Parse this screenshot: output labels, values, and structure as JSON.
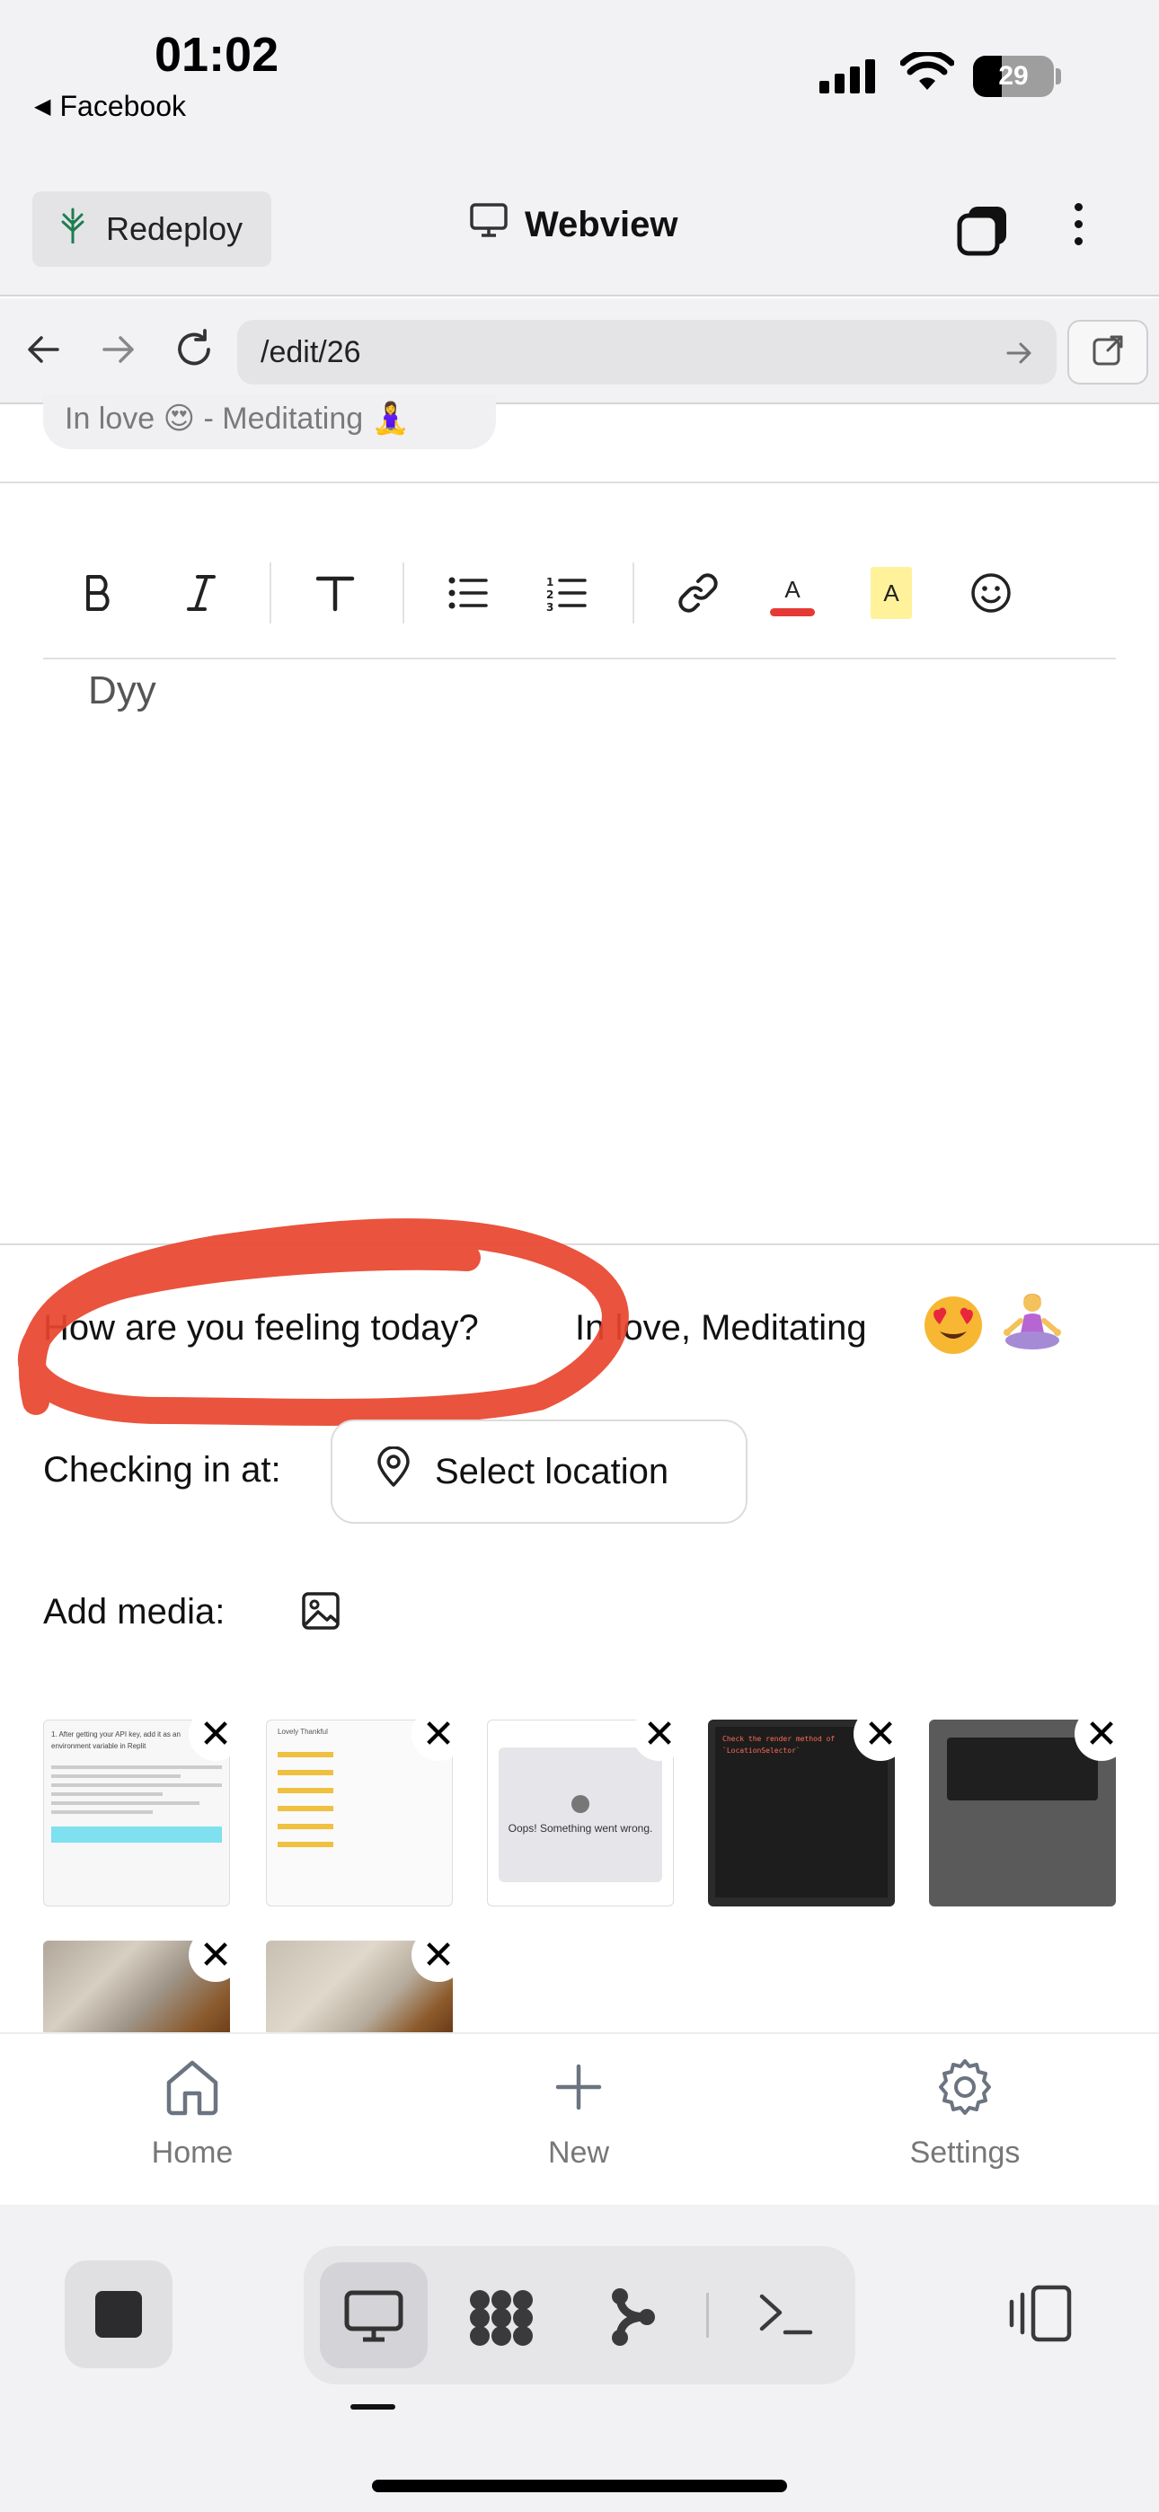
{
  "status_bar": {
    "time": "01:02",
    "back_app": "Facebook",
    "battery": "29"
  },
  "app_bar": {
    "redeploy_label": "Redeploy",
    "title": "Webview"
  },
  "url_bar": {
    "url": "/edit/26"
  },
  "editor": {
    "mood_chip": "In love 😍 - Meditating 🧘‍♀️",
    "toolbar": [
      "bold-icon",
      "italic-icon",
      "text-size-icon",
      "bullet-list-icon",
      "numbered-list-icon",
      "link-icon",
      "text-color-icon",
      "highlight-icon",
      "emoji-icon"
    ],
    "accent_red": "#e53935",
    "highlight_yellow": "#fff29a",
    "content": "Dyy"
  },
  "feeling": {
    "question": "How are you feeling today?",
    "answer": "In love, Meditating",
    "emoji_love": "😍",
    "emoji_meditate": "🧘‍♀️",
    "annotation_color": "#e8442c"
  },
  "checkin": {
    "label": "Checking in at:",
    "button": "Select location"
  },
  "media": {
    "label": "Add media:",
    "thumbs": [
      {
        "kind": "document-screenshot",
        "text": "1. After getting your API key, add it as an environment variable in Replit"
      },
      {
        "kind": "mood-list-screenshot",
        "text": "Lovely  Thankful"
      },
      {
        "kind": "error-screenshot",
        "text": "Oops! Something went wrong."
      },
      {
        "kind": "dark-code-screenshot",
        "text": "Check the render method of `LocationSelector`"
      },
      {
        "kind": "dark-overlay-screenshot",
        "text": ""
      },
      {
        "kind": "photo-carpet",
        "text": ""
      },
      {
        "kind": "photo-carpet",
        "text": ""
      }
    ]
  },
  "bottom_nav": {
    "home": "Home",
    "new": "New",
    "settings": "Settings"
  }
}
